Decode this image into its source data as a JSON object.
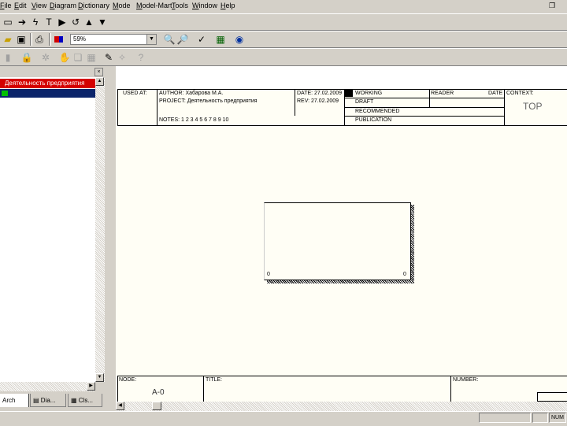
{
  "menu": [
    "File",
    "Edit",
    "View",
    "Diagram",
    "Dictionary",
    "Mode",
    "Model-Mart",
    "Tools",
    "Window",
    "Help"
  ],
  "menu_restore_icon": "restore-icon",
  "toolbar_row1_icons": [
    "rectangle-icon",
    "pointer-arrow-icon",
    "lightning-icon",
    "text-tool-icon",
    "play-icon",
    "rotate-icon",
    "triangle-up-icon",
    "triangle-down-icon"
  ],
  "toolbar_row2_icons": [
    "open-folder-icon",
    "save-icon",
    "print-icon",
    "color-icon",
    "zoom-in-icon",
    "zoom-out-icon",
    "check-icon",
    "model-icon",
    "globe-icon"
  ],
  "toolbar_row3_icons": [
    "stop-icon",
    "lock-icon",
    "settings-icon",
    "hand-icon",
    "copy-icon",
    "grid-icon",
    "palette-icon",
    "wand-icon",
    "help-icon"
  ],
  "zoom": {
    "value": "59%"
  },
  "model_tree": {
    "root_label": "Деятельность предприятия",
    "selected_node": ""
  },
  "panel_tabs": [
    "Arch",
    "Dia...",
    "Cls..."
  ],
  "diagram_header": {
    "used_at": "USED AT:",
    "author": "AUTHOR: Хабарова М.А.",
    "project": "PROJECT: Деятельность предприятия",
    "date": "DATE: 27.02.2009",
    "rev": "REV: 27.02.2009",
    "notes": "NOTES: 1 2 3 4 5 6 7 8 9 10",
    "working": "WORKING",
    "draft": "DRAFT",
    "recommended": "RECOMMENDED",
    "publication": "PUBLICATION",
    "reader": "READER",
    "date_col": "DATE",
    "context": "CONTEXT:",
    "context_value": "TOP"
  },
  "activity_box": {
    "label": "",
    "left_mark": "0",
    "right_mark": "0"
  },
  "diagram_footer": {
    "node_label": "NODE:",
    "node_value": "A-0",
    "title_label": "TITLE:",
    "number_label": "NUMBER:"
  },
  "status": {
    "num": "NUM"
  }
}
